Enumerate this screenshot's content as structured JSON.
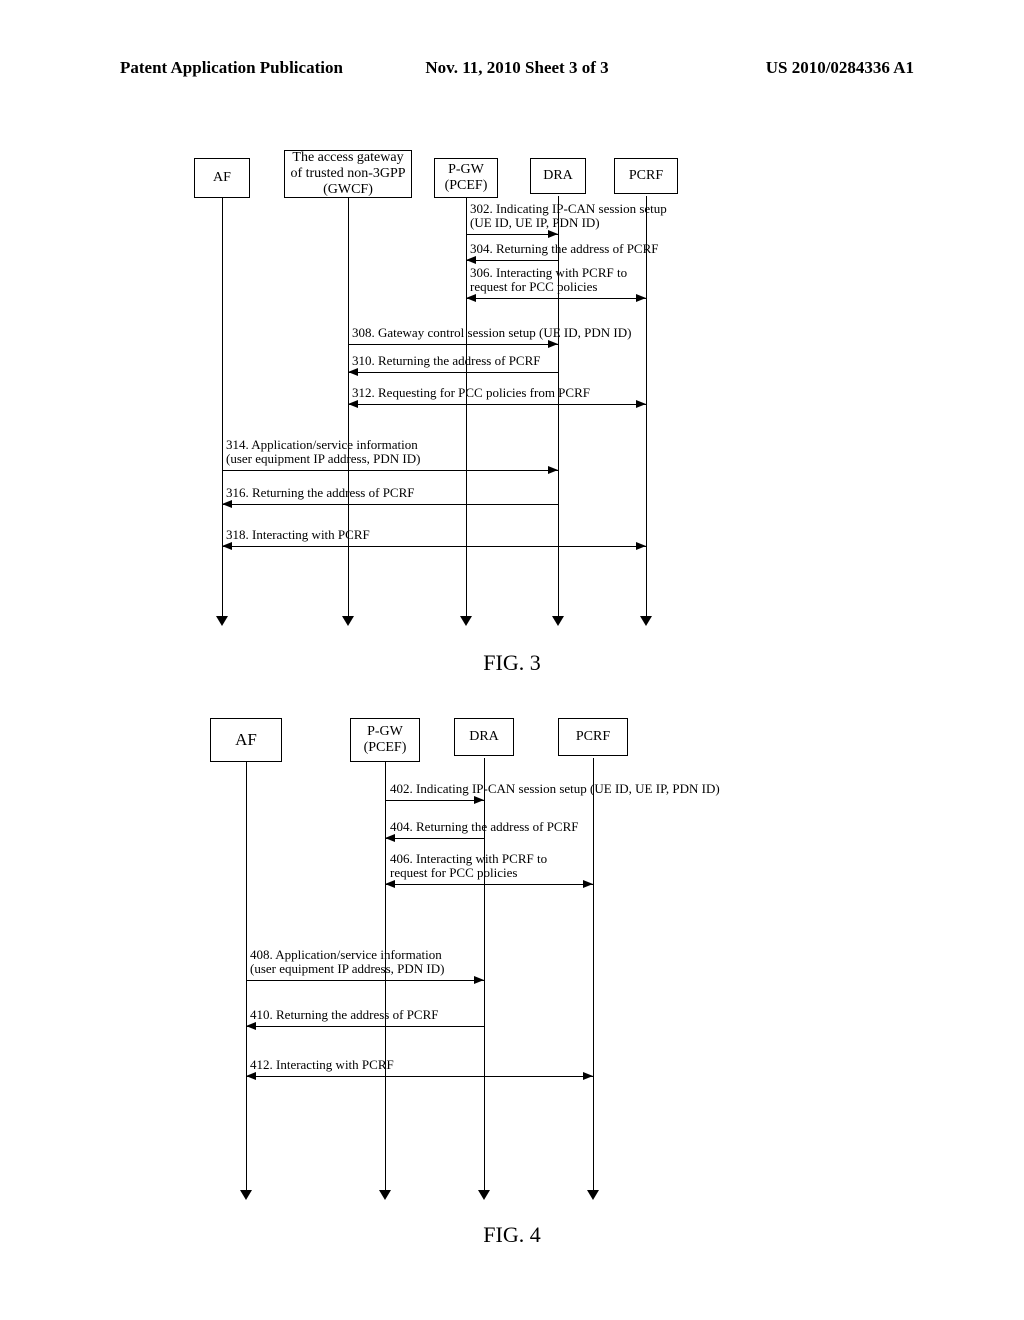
{
  "header": {
    "left": "Patent Application Publication",
    "center": "Nov. 11, 2010  Sheet 3 of 3",
    "right": "US 2010/0284336 A1"
  },
  "fig3": {
    "caption": "FIG. 3",
    "lifelines": {
      "af": "AF",
      "gwcf": "The access gateway\nof trusted\nnon-3GPP (GWCF)",
      "pgw": "P-GW\n(PCEF)",
      "dra": "DRA",
      "pcrf": "PCRF"
    },
    "messages": {
      "m302": "302. Indicating IP-CAN session setup\n(UE ID, UE IP, PDN ID)",
      "m304": "304. Returning the address of PCRF",
      "m306": "306. Interacting with PCRF to\nrequest for PCC policies",
      "m308": "308. Gateway control session setup (UE ID, PDN ID)",
      "m310": "310. Returning the address of PCRF",
      "m312": "312. Requesting for PCC policies from PCRF",
      "m314": "314. Application/service information\n(user equipment IP address, PDN ID)",
      "m316": "316. Returning the address of PCRF",
      "m318": "318. Interacting with PCRF"
    }
  },
  "fig4": {
    "caption": "FIG. 4",
    "lifelines": {
      "af": "AF",
      "pgw": "P-GW\n(PCEF)",
      "dra": "DRA",
      "pcrf": "PCRF"
    },
    "messages": {
      "m402": "402. Indicating IP-CAN session setup (UE ID, UE IP, PDN ID)",
      "m404": "404. Returning the address of PCRF",
      "m406": "406. Interacting with PCRF to\nrequest for PCC policies",
      "m408": "408. Application/service information\n(user equipment IP address, PDN ID)",
      "m410": "410. Returning the address of PCRF",
      "m412": "412. Interacting with PCRF"
    }
  }
}
